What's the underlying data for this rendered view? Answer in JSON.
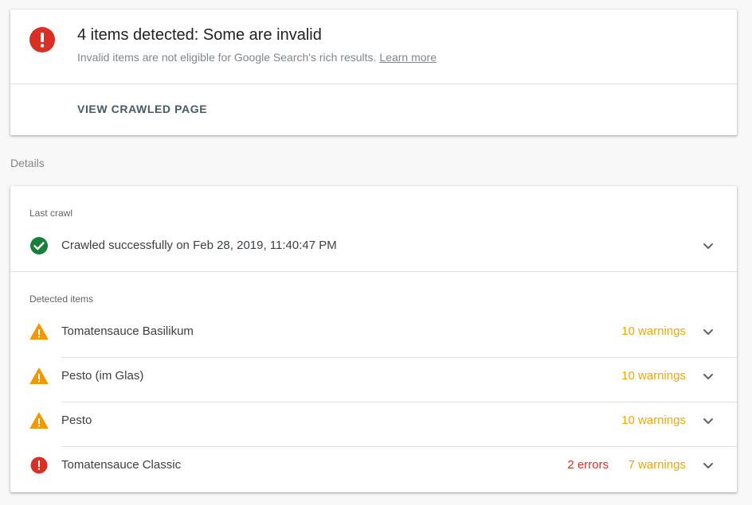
{
  "summary": {
    "title": "4 items detected: Some are invalid",
    "subtitle": "Invalid items are not eligible for Google Search's rich results.",
    "learn_more": "Learn more",
    "view_button": "VIEW CRAWLED PAGE"
  },
  "details": {
    "label": "Details",
    "last_crawl": {
      "label": "Last crawl",
      "status": "Crawled successfully on Feb 28, 2019, 11:40:47 PM"
    },
    "detected_items": {
      "label": "Detected items",
      "items": [
        {
          "name": "Tomatensauce Basilikum",
          "errors": "",
          "warnings": "10 warnings",
          "icon": "warning-icon"
        },
        {
          "name": "Pesto (im Glas)",
          "errors": "",
          "warnings": "10 warnings",
          "icon": "warning-icon"
        },
        {
          "name": "Pesto",
          "errors": "",
          "warnings": "10 warnings",
          "icon": "warning-icon"
        },
        {
          "name": "Tomatensauce Classic",
          "errors": "2 errors",
          "warnings": "7 warnings",
          "icon": "error-icon"
        }
      ]
    }
  },
  "colors": {
    "error": "#d93025",
    "warning": "#f2a600",
    "success": "#188038",
    "text_secondary": "#80868b"
  }
}
